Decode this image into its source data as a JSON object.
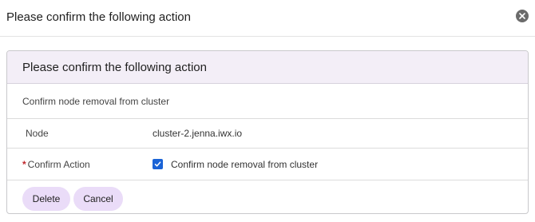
{
  "dialog": {
    "title": "Please confirm the following action"
  },
  "panel": {
    "title": "Please confirm the following action",
    "description": "Confirm node removal from cluster",
    "rows": [
      {
        "label": "Node",
        "value": "cluster-2.jenna.iwx.io"
      }
    ],
    "confirm": {
      "required_marker": "*",
      "label": "Confirm Action",
      "checked": true,
      "checkbox_label": "Confirm node removal from cluster"
    }
  },
  "actions": {
    "delete_label": "Delete",
    "cancel_label": "Cancel"
  },
  "colors": {
    "accent": "#1a63d6",
    "button_bg": "#eadcf8",
    "panel_header_bg": "#f3eef7",
    "required": "#c0282d"
  },
  "icons": {
    "close": "close-icon",
    "check": "check-icon"
  }
}
